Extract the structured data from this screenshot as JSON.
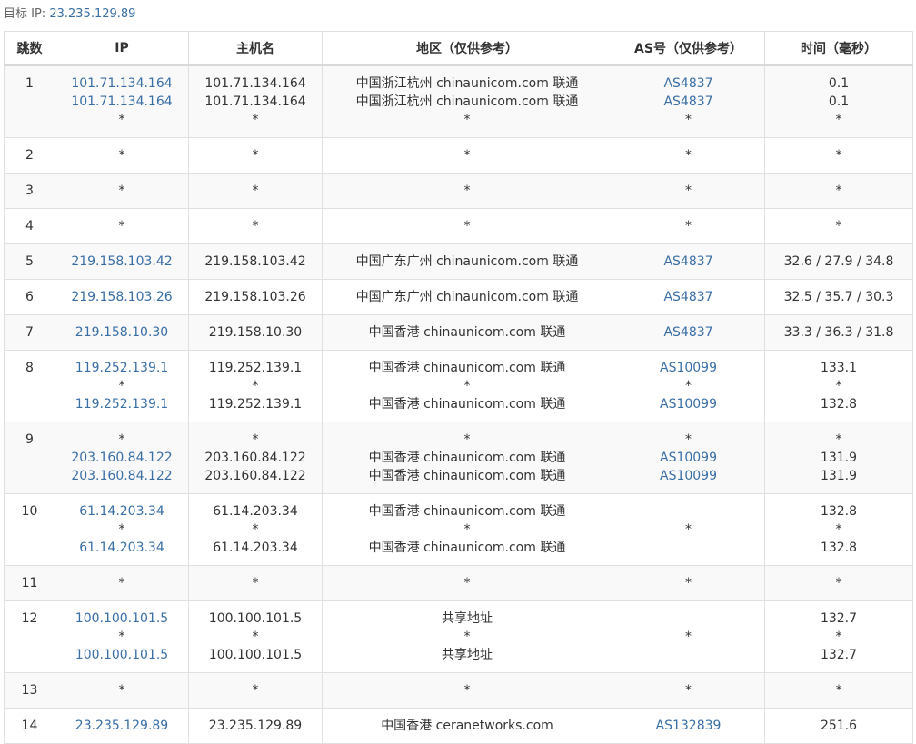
{
  "target": {
    "label": "目标 IP:",
    "ip": "23.235.129.89"
  },
  "headers": [
    "跳数",
    "IP",
    "主机名",
    "地区（仅供参考）",
    "AS号（仅供参考）",
    "时间（毫秒）"
  ],
  "rows": [
    {
      "hop": "1",
      "ip": [
        "101.71.134.164",
        "101.71.134.164",
        "*"
      ],
      "host": [
        "101.71.134.164",
        "101.71.134.164",
        "*"
      ],
      "region": [
        "中国浙江杭州 chinaunicom.com 联通",
        "中国浙江杭州 chinaunicom.com 联通",
        "*"
      ],
      "as": [
        "AS4837",
        "AS4837",
        "*"
      ],
      "time": [
        "0.1",
        "0.1",
        "*"
      ]
    },
    {
      "hop": "2",
      "ip": [
        "*"
      ],
      "host": [
        "*"
      ],
      "region": [
        "*"
      ],
      "as": [
        "*"
      ],
      "time": [
        "*"
      ]
    },
    {
      "hop": "3",
      "ip": [
        "*"
      ],
      "host": [
        "*"
      ],
      "region": [
        "*"
      ],
      "as": [
        "*"
      ],
      "time": [
        "*"
      ]
    },
    {
      "hop": "4",
      "ip": [
        "*"
      ],
      "host": [
        "*"
      ],
      "region": [
        "*"
      ],
      "as": [
        "*"
      ],
      "time": [
        "*"
      ]
    },
    {
      "hop": "5",
      "ip": [
        "219.158.103.42"
      ],
      "host": [
        "219.158.103.42"
      ],
      "region": [
        "中国广东广州 chinaunicom.com 联通"
      ],
      "as": [
        "AS4837"
      ],
      "time": [
        "32.6 / 27.9 / 34.8"
      ]
    },
    {
      "hop": "6",
      "ip": [
        "219.158.103.26"
      ],
      "host": [
        "219.158.103.26"
      ],
      "region": [
        "中国广东广州 chinaunicom.com 联通"
      ],
      "as": [
        "AS4837"
      ],
      "time": [
        "32.5 / 35.7 / 30.3"
      ]
    },
    {
      "hop": "7",
      "ip": [
        "219.158.10.30"
      ],
      "host": [
        "219.158.10.30"
      ],
      "region": [
        "中国香港 chinaunicom.com 联通"
      ],
      "as": [
        "AS4837"
      ],
      "time": [
        "33.3 / 36.3 / 31.8"
      ]
    },
    {
      "hop": "8",
      "ip": [
        "119.252.139.1",
        "*",
        "119.252.139.1"
      ],
      "host": [
        "119.252.139.1",
        "*",
        "119.252.139.1"
      ],
      "region": [
        "中国香港 chinaunicom.com 联通",
        "*",
        "中国香港 chinaunicom.com 联通"
      ],
      "as": [
        "AS10099",
        "*",
        "AS10099"
      ],
      "time": [
        "133.1",
        "*",
        "132.8"
      ]
    },
    {
      "hop": "9",
      "ip": [
        "*",
        "203.160.84.122",
        "203.160.84.122"
      ],
      "host": [
        "*",
        "203.160.84.122",
        "203.160.84.122"
      ],
      "region": [
        "*",
        "中国香港 chinaunicom.com 联通",
        "中国香港 chinaunicom.com 联通"
      ],
      "as": [
        "*",
        "AS10099",
        "AS10099"
      ],
      "time": [
        "*",
        "131.9",
        "131.9"
      ]
    },
    {
      "hop": "10",
      "ip": [
        "61.14.203.34",
        "*",
        "61.14.203.34"
      ],
      "host": [
        "61.14.203.34",
        "*",
        "61.14.203.34"
      ],
      "region": [
        "中国香港 chinaunicom.com 联通",
        "*",
        "中国香港 chinaunicom.com 联通"
      ],
      "as": [
        "*"
      ],
      "time": [
        "132.8",
        "*",
        "132.8"
      ]
    },
    {
      "hop": "11",
      "ip": [
        "*"
      ],
      "host": [
        "*"
      ],
      "region": [
        "*"
      ],
      "as": [
        "*"
      ],
      "time": [
        "*"
      ]
    },
    {
      "hop": "12",
      "ip": [
        "100.100.101.5",
        "*",
        "100.100.101.5"
      ],
      "host": [
        "100.100.101.5",
        "*",
        "100.100.101.5"
      ],
      "region": [
        "共享地址",
        "*",
        "共享地址"
      ],
      "as": [
        "*"
      ],
      "time": [
        "132.7",
        "*",
        "132.7"
      ]
    },
    {
      "hop": "13",
      "ip": [
        "*"
      ],
      "host": [
        "*"
      ],
      "region": [
        "*"
      ],
      "as": [
        "*"
      ],
      "time": [
        "*"
      ]
    },
    {
      "hop": "14",
      "ip": [
        "23.235.129.89"
      ],
      "host": [
        "23.235.129.89"
      ],
      "region": [
        "中国香港 ceranetworks.com"
      ],
      "as": [
        "AS132839"
      ],
      "time": [
        "251.6"
      ]
    }
  ]
}
